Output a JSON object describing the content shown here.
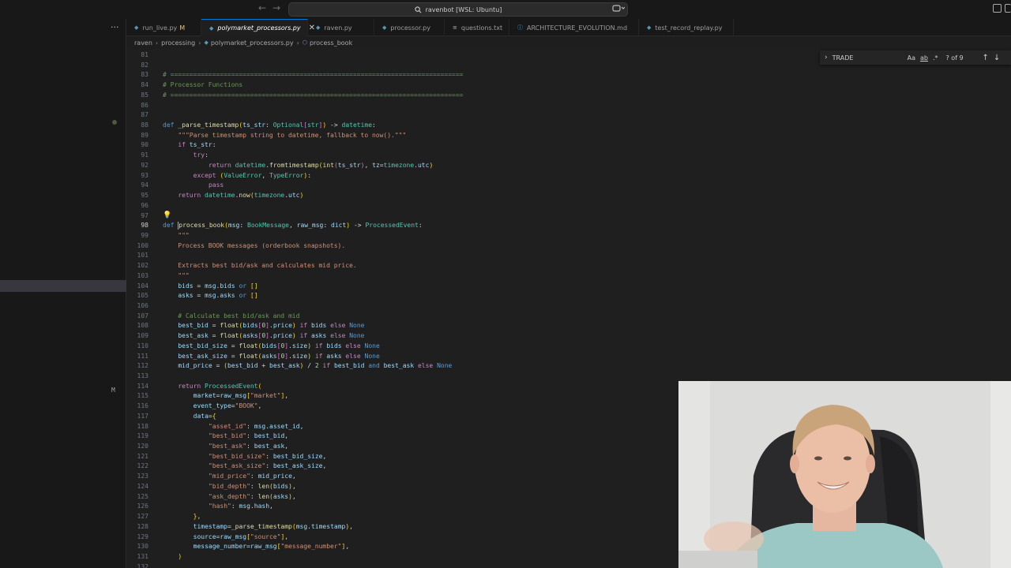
{
  "titlebar": {
    "back_arrow": "←",
    "forward_arrow": "→",
    "command_center": "ravenbot [WSL: Ubuntu]",
    "search_icon": "search-icon",
    "copilot_icon": "copilot-icon"
  },
  "left_panel": {
    "more_dots": "···",
    "git_marker": "M"
  },
  "tabs": [
    {
      "label": "run_live.py",
      "icon": "py",
      "modified": "M",
      "active": false
    },
    {
      "label": "polymarket_processors.py",
      "icon": "py",
      "active": true,
      "close": "✕"
    },
    {
      "label": "raven.py",
      "icon": "py",
      "active": false
    },
    {
      "label": "processor.py",
      "icon": "py",
      "active": false
    },
    {
      "label": "questions.txt",
      "icon": "txt",
      "active": false
    },
    {
      "label": "ARCHITECTURE_EVOLUTION.md",
      "icon": "md",
      "active": false
    },
    {
      "label": "test_record_replay.py",
      "icon": "py",
      "active": false
    }
  ],
  "breadcrumb": {
    "parts": [
      "raven",
      "processing",
      "polymarket_processors.py",
      "process_book"
    ]
  },
  "find_widget": {
    "query": "TRADE",
    "match_case": "Aa",
    "whole_word": "ab",
    "regex": ".*",
    "count": "? of 9",
    "up_arrow": "↑",
    "down_arrow": "↓",
    "toggle": "›"
  },
  "editor": {
    "current_line": 98,
    "lines": [
      {
        "n": 81,
        "code": ""
      },
      {
        "n": 82,
        "code": ""
      },
      {
        "n": 83,
        "code": "# ============================================================================="
      },
      {
        "n": 84,
        "code": "# Processor Functions"
      },
      {
        "n": 85,
        "code": "# ============================================================================="
      },
      {
        "n": 86,
        "code": ""
      },
      {
        "n": 87,
        "code": ""
      },
      {
        "n": 88,
        "code": "def _parse_timestamp(ts_str: Optional[str]) -> datetime:"
      },
      {
        "n": 89,
        "code": "    \"\"\"Parse timestamp string to datetime, fallback to now().\"\"\""
      },
      {
        "n": 90,
        "code": "    if ts_str:"
      },
      {
        "n": 91,
        "code": "        try:"
      },
      {
        "n": 92,
        "code": "            return datetime.fromtimestamp(int(ts_str), tz=timezone.utc)"
      },
      {
        "n": 93,
        "code": "        except (ValueError, TypeError):"
      },
      {
        "n": 94,
        "code": "            pass"
      },
      {
        "n": 95,
        "code": "    return datetime.now(timezone.utc)"
      },
      {
        "n": 96,
        "code": ""
      },
      {
        "n": 97,
        "code": ""
      },
      {
        "n": 98,
        "code": "def process_book(msg: BookMessage, raw_msg: dict) -> ProcessedEvent:"
      },
      {
        "n": 99,
        "code": "    \"\"\""
      },
      {
        "n": 100,
        "code": "    Process BOOK messages (orderbook snapshots)."
      },
      {
        "n": 101,
        "code": ""
      },
      {
        "n": 102,
        "code": "    Extracts best bid/ask and calculates mid price."
      },
      {
        "n": 103,
        "code": "    \"\"\""
      },
      {
        "n": 104,
        "code": "    bids = msg.bids or []"
      },
      {
        "n": 105,
        "code": "    asks = msg.asks or []"
      },
      {
        "n": 106,
        "code": ""
      },
      {
        "n": 107,
        "code": "    # Calculate best bid/ask and mid"
      },
      {
        "n": 108,
        "code": "    best_bid = float(bids[0].price) if bids else None"
      },
      {
        "n": 109,
        "code": "    best_ask = float(asks[0].price) if asks else None"
      },
      {
        "n": 110,
        "code": "    best_bid_size = float(bids[0].size) if bids else None"
      },
      {
        "n": 111,
        "code": "    best_ask_size = float(asks[0].size) if asks else None"
      },
      {
        "n": 112,
        "code": "    mid_price = (best_bid + best_ask) / 2 if best_bid and best_ask else None"
      },
      {
        "n": 113,
        "code": ""
      },
      {
        "n": 114,
        "code": "    return ProcessedEvent("
      },
      {
        "n": 115,
        "code": "        market=raw_msg[\"market\"],"
      },
      {
        "n": 116,
        "code": "        event_type=\"BOOK\","
      },
      {
        "n": 117,
        "code": "        data={"
      },
      {
        "n": 118,
        "code": "            \"asset_id\": msg.asset_id,"
      },
      {
        "n": 119,
        "code": "            \"best_bid\": best_bid,"
      },
      {
        "n": 120,
        "code": "            \"best_ask\": best_ask,"
      },
      {
        "n": 121,
        "code": "            \"best_bid_size\": best_bid_size,"
      },
      {
        "n": 122,
        "code": "            \"best_ask_size\": best_ask_size,"
      },
      {
        "n": 123,
        "code": "            \"mid_price\": mid_price,"
      },
      {
        "n": 124,
        "code": "            \"bid_depth\": len(bids),"
      },
      {
        "n": 125,
        "code": "            \"ask_depth\": len(asks),"
      },
      {
        "n": 126,
        "code": "            \"hash\": msg.hash,"
      },
      {
        "n": 127,
        "code": "        },"
      },
      {
        "n": 128,
        "code": "        timestamp=_parse_timestamp(msg.timestamp),"
      },
      {
        "n": 129,
        "code": "        source=raw_msg[\"source\"],"
      },
      {
        "n": 130,
        "code": "        message_number=raw_msg[\"message_number\"],"
      },
      {
        "n": 131,
        "code": "    )"
      },
      {
        "n": 132,
        "code": ""
      }
    ]
  },
  "colors": {
    "accent": "#0078d4",
    "editor_bg": "#1f1f1f",
    "keyword": "#569cd6",
    "function": "#dcdcaa",
    "string": "#ce9178",
    "comment": "#6a9955",
    "type": "#4ec9b0"
  },
  "webcam": {
    "description_icon": "webcam-overlay"
  }
}
